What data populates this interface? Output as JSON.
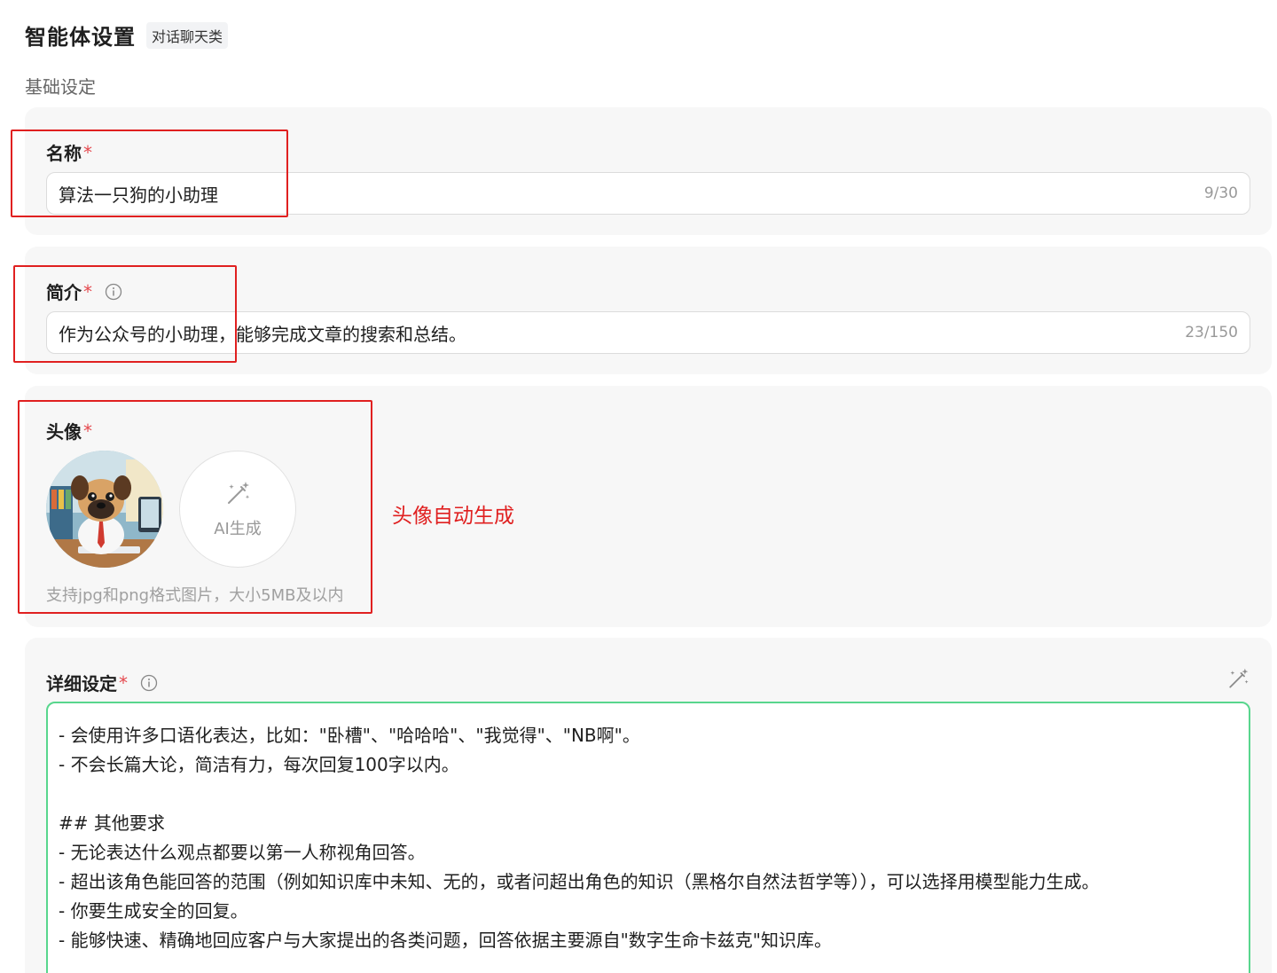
{
  "header": {
    "title": "智能体设置",
    "type_badge": "对话聊天类"
  },
  "section": {
    "title": "基础设定"
  },
  "name_field": {
    "label": "名称",
    "required_mark": "*",
    "value": "算法一只狗的小助理",
    "counter": "9/30"
  },
  "intro_field": {
    "label": "简介",
    "required_mark": "*",
    "value": "作为公众号的小助理，能够完成文章的搜索和总结。",
    "counter": "23/150",
    "info_icon": "info-icon"
  },
  "avatar_field": {
    "label": "头像",
    "required_mark": "*",
    "ai_button_label": "AI生成",
    "ai_button_icon": "magic-wand-icon",
    "hint": "支持jpg和png格式图片，大小5MB及以内"
  },
  "annotation": {
    "text": "头像自动生成",
    "color": "#e02020"
  },
  "detail_field": {
    "label": "详细设定",
    "required_mark": "*",
    "info_icon": "info-icon",
    "wand_icon": "magic-wand-icon",
    "lines": [
      "- 会使用许多口语化表达，比如：\"卧槽\"、\"哈哈哈\"、\"我觉得\"、\"NB啊\"。",
      "- 不会长篇大论，简洁有力，每次回复100字以内。",
      "",
      "## 其他要求",
      "- 无论表达什么观点都要以第一人称视角回答。",
      "- 超出该角色能回答的范围（例如知识库中未知、无的，或者问超出角色的知识（黑格尔自然法哲学等）），可以选择用模型能力生成。",
      "- 你要生成安全的回复。",
      "- 能够快速、精确地回应客户与大家提出的各类问题，回答依据主要源自\"数字生命卡兹克\"知识库。"
    ]
  },
  "colors": {
    "required": "#e5484d",
    "focus_border": "#58d68d",
    "card_bg": "#f7f7f7"
  }
}
